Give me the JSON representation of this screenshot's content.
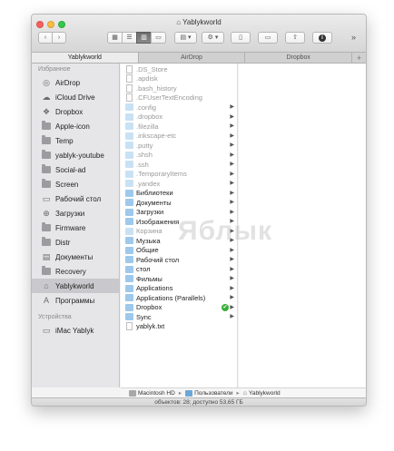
{
  "window": {
    "title": "Yablykworld",
    "home_icon": "house-icon"
  },
  "toolbar": {
    "back": "‹",
    "forward": "›",
    "view_icons": "▦",
    "view_list": "☰",
    "view_columns": "▥",
    "view_cover": "▭",
    "arrange": "▤ ▾",
    "action": "⚙ ▾",
    "trash": "▯",
    "new_folder": "▭",
    "share": "⇧",
    "info": "i",
    "overflow": "»"
  },
  "tabs": [
    {
      "label": "Yablykworld",
      "active": true
    },
    {
      "label": "AirDrop",
      "active": false
    },
    {
      "label": "Dropbox",
      "active": false
    }
  ],
  "tab_add": "+",
  "sidebar": {
    "favorites_heading": "Избранное",
    "favorites": [
      {
        "label": "AirDrop",
        "icon": "airdrop-icon",
        "glyph": "◎"
      },
      {
        "label": "iCloud Drive",
        "icon": "cloud-icon",
        "glyph": "☁"
      },
      {
        "label": "Dropbox",
        "icon": "dropbox-icon",
        "glyph": "❖"
      },
      {
        "label": "Apple-icon",
        "icon": "folder-icon",
        "glyph": ""
      },
      {
        "label": "Temp",
        "icon": "folder-icon",
        "glyph": ""
      },
      {
        "label": "yablyk-youtube",
        "icon": "folder-icon",
        "glyph": ""
      },
      {
        "label": "Social-ad",
        "icon": "folder-icon",
        "glyph": ""
      },
      {
        "label": "Screen",
        "icon": "folder-icon",
        "glyph": ""
      },
      {
        "label": "Рабочий стол",
        "icon": "desktop-icon",
        "glyph": "▭"
      },
      {
        "label": "Загрузки",
        "icon": "downloads-icon",
        "glyph": "⊕"
      },
      {
        "label": "Firmware",
        "icon": "folder-icon",
        "glyph": ""
      },
      {
        "label": "Distr",
        "icon": "folder-icon",
        "glyph": ""
      },
      {
        "label": "Документы",
        "icon": "documents-icon",
        "glyph": "▤"
      },
      {
        "label": "Recovery",
        "icon": "folder-icon",
        "glyph": ""
      },
      {
        "label": "Yablykworld",
        "icon": "home-icon",
        "glyph": "⌂",
        "selected": true
      },
      {
        "label": "Программы",
        "icon": "applications-icon",
        "glyph": "A"
      }
    ],
    "devices_heading": "Устройства",
    "devices": [
      {
        "label": "iMac Yablyk",
        "icon": "imac-icon",
        "glyph": "▭"
      }
    ]
  },
  "column1": [
    {
      "label": ".DS_Store",
      "kind": "file",
      "dim": true,
      "arrow": false
    },
    {
      "label": ".apdisk",
      "kind": "file",
      "dim": true,
      "arrow": false
    },
    {
      "label": ".bash_history",
      "kind": "file",
      "dim": true,
      "arrow": false
    },
    {
      "label": ".CFUserTextEncoding",
      "kind": "file",
      "dim": true,
      "arrow": false
    },
    {
      "label": ".config",
      "kind": "folder-dim",
      "dim": true,
      "arrow": true
    },
    {
      "label": ".dropbox",
      "kind": "folder-dim",
      "dim": true,
      "arrow": true
    },
    {
      "label": ".filezilla",
      "kind": "folder-dim",
      "dim": true,
      "arrow": true
    },
    {
      "label": ".inkscape-etc",
      "kind": "folder-dim",
      "dim": true,
      "arrow": true
    },
    {
      "label": ".putty",
      "kind": "folder-dim",
      "dim": true,
      "arrow": true
    },
    {
      "label": ".shsh",
      "kind": "folder-dim",
      "dim": true,
      "arrow": true
    },
    {
      "label": ".ssh",
      "kind": "folder-dim",
      "dim": true,
      "arrow": true
    },
    {
      "label": ".TemporaryItems",
      "kind": "folder-dim",
      "dim": true,
      "arrow": true
    },
    {
      "label": ".yandex",
      "kind": "folder-dim",
      "dim": true,
      "arrow": true
    },
    {
      "label": "Библиотеки",
      "kind": "folder",
      "dim": false,
      "arrow": true
    },
    {
      "label": "Документы",
      "kind": "folder",
      "dim": false,
      "arrow": true
    },
    {
      "label": "Загрузки",
      "kind": "folder",
      "dim": false,
      "arrow": true
    },
    {
      "label": "Изображения",
      "kind": "folder",
      "dim": false,
      "arrow": true
    },
    {
      "label": "Корзина",
      "kind": "folder-dim",
      "dim": true,
      "arrow": true
    },
    {
      "label": "Музыка",
      "kind": "folder",
      "dim": false,
      "arrow": true
    },
    {
      "label": "Общие",
      "kind": "folder",
      "dim": false,
      "arrow": true
    },
    {
      "label": "Рабочий стол",
      "kind": "folder",
      "dim": false,
      "arrow": true
    },
    {
      "label": "стол",
      "kind": "folder",
      "dim": false,
      "arrow": true
    },
    {
      "label": "Фильмы",
      "kind": "folder",
      "dim": false,
      "arrow": true
    },
    {
      "label": "Applications",
      "kind": "folder",
      "dim": false,
      "arrow": true
    },
    {
      "label": "Applications (Parallels)",
      "kind": "folder",
      "dim": false,
      "arrow": true
    },
    {
      "label": "Dropbox",
      "kind": "folder",
      "dim": false,
      "arrow": true,
      "synced": true
    },
    {
      "label": "Sync",
      "kind": "folder",
      "dim": false,
      "arrow": true
    },
    {
      "label": "yablyk.txt",
      "kind": "file",
      "dim": false,
      "arrow": false
    }
  ],
  "sync_check": "✔",
  "row_arrow": "▶",
  "watermark": "Яблык",
  "pathbar": {
    "disk": "Macintosh HD",
    "users": "Пользователи",
    "home": "Yablykworld",
    "sep": "▸",
    "home_glyph": "⌂"
  },
  "status": "объектов: 28; доступно 53,65 ГБ"
}
